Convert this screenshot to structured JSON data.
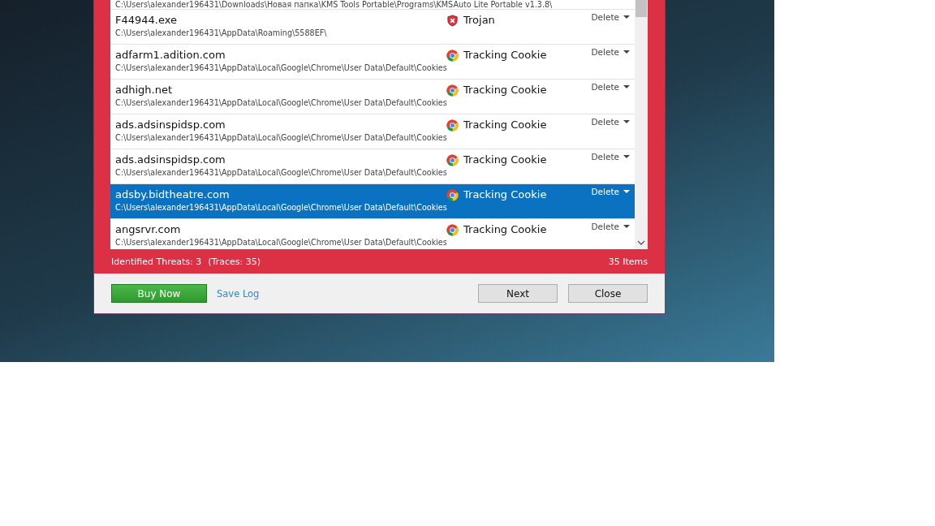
{
  "list": {
    "rows": [
      {
        "path": "C:\\Users\\alexander196431\\Downloads\\Новая папка\\KMS Tools Portable\\Programs\\KMSAuto Lite Portable v1.3.8\\",
        "kind": "partial"
      },
      {
        "name": "F44944.exe",
        "path": "C:\\Users\\alexander196431\\AppData\\Roaming\\5588EF\\",
        "kind": "trojan",
        "threat": "Trojan",
        "action": "Delete",
        "selected": false
      },
      {
        "name": "adfarm1.adition.com",
        "path": "C:\\Users\\alexander196431\\AppData\\Local\\Google\\Chrome\\User Data\\Default\\Cookies",
        "kind": "cookie",
        "threat": "Tracking Cookie",
        "action": "Delete",
        "selected": false
      },
      {
        "name": "adhigh.net",
        "path": "C:\\Users\\alexander196431\\AppData\\Local\\Google\\Chrome\\User Data\\Default\\Cookies",
        "kind": "cookie",
        "threat": "Tracking Cookie",
        "action": "Delete",
        "selected": false
      },
      {
        "name": "ads.adsinspidsp.com",
        "path": "C:\\Users\\alexander196431\\AppData\\Local\\Google\\Chrome\\User Data\\Default\\Cookies",
        "kind": "cookie",
        "threat": "Tracking Cookie",
        "action": "Delete",
        "selected": false
      },
      {
        "name": "ads.adsinspidsp.com",
        "path": "C:\\Users\\alexander196431\\AppData\\Local\\Google\\Chrome\\User Data\\Default\\Cookies",
        "kind": "cookie",
        "threat": "Tracking Cookie",
        "action": "Delete",
        "selected": false
      },
      {
        "name": "adsby.bidtheatre.com",
        "path": "C:\\Users\\alexander196431\\AppData\\Local\\Google\\Chrome\\User Data\\Default\\Cookies",
        "kind": "cookie",
        "threat": "Tracking Cookie",
        "action": "Delete",
        "selected": true
      },
      {
        "name": "angsrvr.com",
        "path": "C:\\Users\\alexander196431\\AppData\\Local\\Google\\Chrome\\User Data\\Default\\Cookies",
        "kind": "cookie",
        "threat": "Tracking Cookie",
        "action": "Delete",
        "selected": false
      }
    ]
  },
  "status_bar": {
    "threats": "Identified Threats: 3",
    "traces": "(Traces: 35)",
    "items": "35 Items"
  },
  "buttons": {
    "buy": "Buy Now",
    "save_log": "Save Log",
    "next": "Next",
    "close": "Close"
  }
}
